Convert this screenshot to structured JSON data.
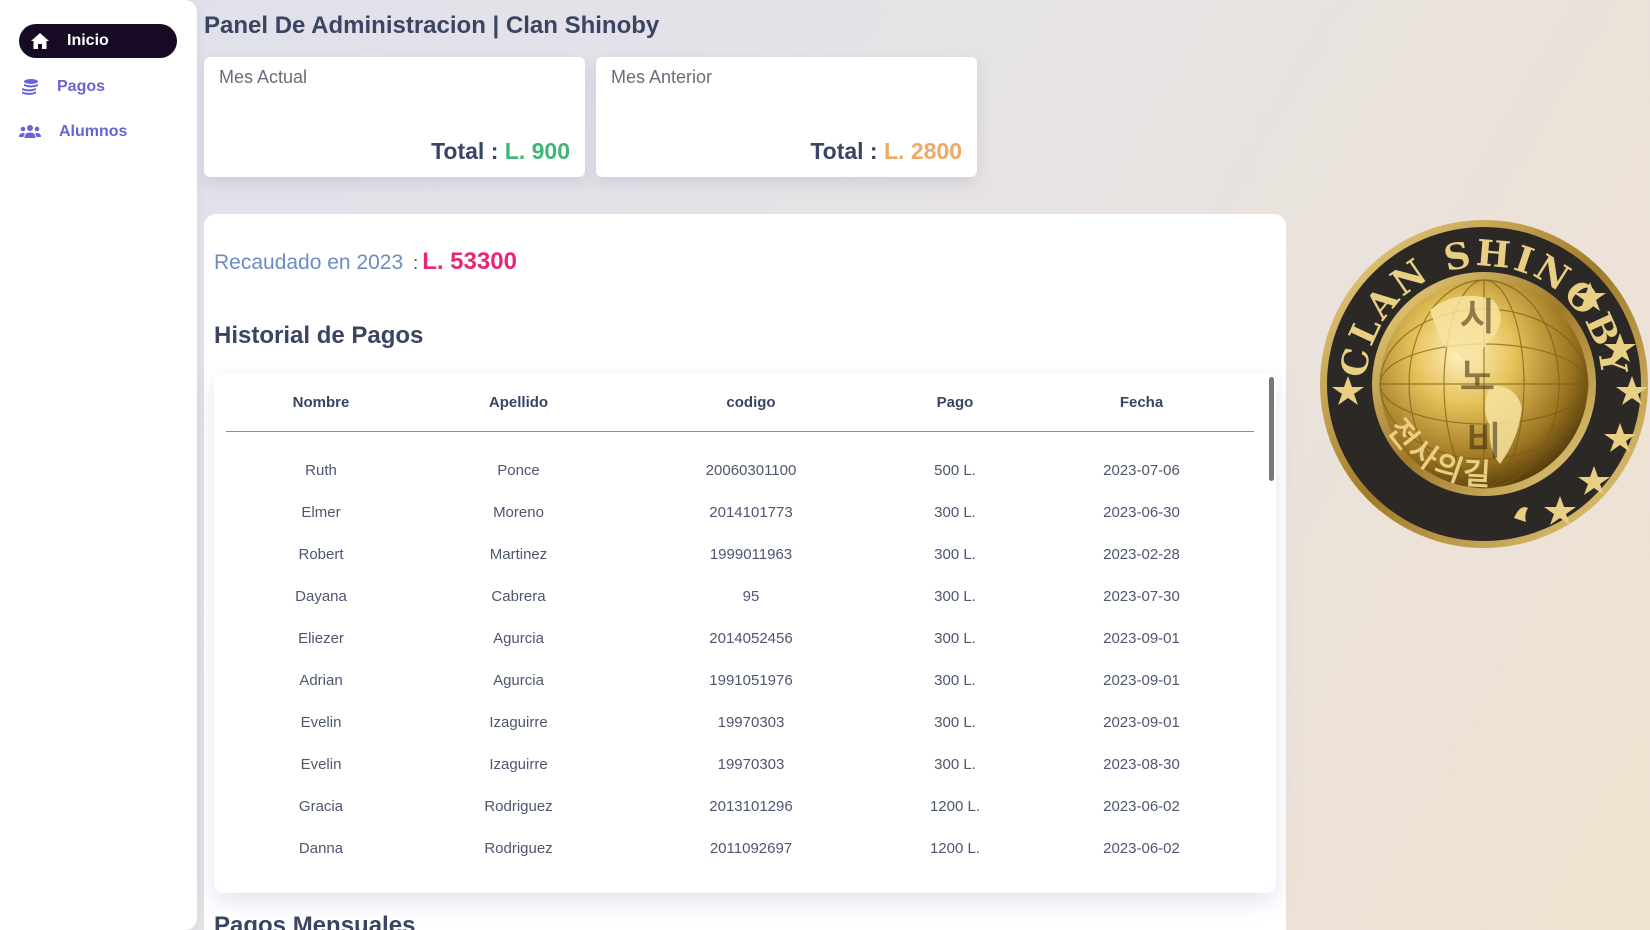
{
  "sidebar": {
    "items": [
      {
        "label": "Inicio",
        "icon": "home-icon",
        "active": true
      },
      {
        "label": "Pagos",
        "icon": "coins-icon",
        "active": false
      },
      {
        "label": "Alumnos",
        "icon": "users-icon",
        "active": false
      }
    ]
  },
  "header": {
    "title": "Panel De Administracion | Clan Shinoby"
  },
  "cards": [
    {
      "title": "Mes Actual",
      "total_label": "Total :",
      "total_value": "L. 900",
      "color": "#3fb57a"
    },
    {
      "title": "Mes Anterior",
      "total_label": "Total :",
      "total_value": "L. 2800",
      "color": "#f0a865"
    }
  ],
  "summary": {
    "label": "Recaudado en 2023",
    "separator": ":",
    "value": "L. 53300",
    "color": "#e8267b"
  },
  "history": {
    "title": "Historial de Pagos",
    "columns": [
      "Nombre",
      "Apellido",
      "codigo",
      "Pago",
      "Fecha"
    ],
    "rows": [
      [
        "Ruth",
        "Ponce",
        "20060301100",
        "500 L.",
        "2023-07-06"
      ],
      [
        "Elmer",
        "Moreno",
        "2014101773",
        "300 L.",
        "2023-06-30"
      ],
      [
        "Robert",
        "Martinez",
        "1999011963",
        "300 L.",
        "2023-02-28"
      ],
      [
        "Dayana",
        "Cabrera",
        "95",
        "300 L.",
        "2023-07-30"
      ],
      [
        "Eliezer",
        "Agurcia",
        "2014052456",
        "300 L.",
        "2023-09-01"
      ],
      [
        "Adrian",
        "Agurcia",
        "1991051976",
        "300 L.",
        "2023-09-01"
      ],
      [
        "Evelin",
        "Izaguirre",
        "19970303",
        "300 L.",
        "2023-09-01"
      ],
      [
        "Evelin",
        "Izaguirre",
        "19970303",
        "300 L.",
        "2023-08-30"
      ],
      [
        "Gracia",
        "Rodriguez",
        "2013101296",
        "1200 L.",
        "2023-06-02"
      ],
      [
        "Danna",
        "Rodriguez",
        "2011092697",
        "1200 L.",
        "2023-06-02"
      ]
    ]
  },
  "next_section": {
    "title": "Pagos Mensuales"
  },
  "logo": {
    "text_top": "CLAN SHINOBY",
    "text_bottom": "전사의길",
    "glyphs": [
      "시",
      "노",
      "비"
    ]
  },
  "colors": {
    "sidebar_active": "#170a24",
    "nav_text": "#6a63d4",
    "heading": "#3b4463"
  }
}
